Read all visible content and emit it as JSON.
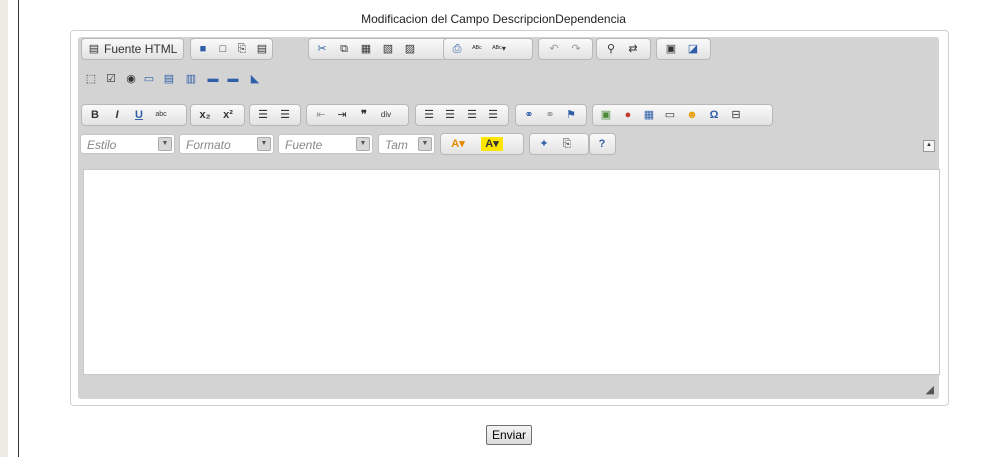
{
  "page": {
    "title": "Modificacion del Campo DescripcionDependencia",
    "submit_label": "Enviar"
  },
  "toolbar1": {
    "source_label": "Fuente HTML",
    "icons": [
      "save-icon",
      "new-page-icon",
      "preview-icon",
      "templates-icon",
      "cut-icon",
      "copy-icon",
      "paste-icon",
      "paste-text-icon",
      "paste-word-icon",
      "print-icon",
      "spellcheck-icon",
      "scayt-icon",
      "undo-icon",
      "redo-icon",
      "find-icon",
      "replace-icon",
      "select-all-icon",
      "remove-format-icon"
    ]
  },
  "toolbar2": {
    "icons": [
      "form-icon",
      "checkbox-icon",
      "radio-icon",
      "text-field-icon",
      "textarea-icon",
      "select-field-icon",
      "button-icon",
      "image-button-icon",
      "hidden-field-icon"
    ]
  },
  "toolbar3": {
    "icons": [
      "bold-icon",
      "italic-icon",
      "underline-icon",
      "strike-icon",
      "subscript-icon",
      "superscript-icon",
      "numbered-list-icon",
      "bulleted-list-icon",
      "outdent-icon",
      "indent-icon",
      "blockquote-icon",
      "creatediv-icon",
      "align-left-icon",
      "align-center-icon",
      "align-right-icon",
      "justify-icon",
      "link-icon",
      "unlink-icon",
      "anchor-icon",
      "image-icon",
      "flash-icon",
      "table-icon",
      "horizontal-rule-icon",
      "smiley-icon",
      "special-char-icon",
      "page-break-icon"
    ]
  },
  "toolbar4": {
    "style_placeholder": "Estilo",
    "format_placeholder": "Formato",
    "font_placeholder": "Fuente",
    "size_placeholder": "Tam",
    "icons": [
      "text-color-icon",
      "bg-color-icon",
      "maximize-icon",
      "show-blocks-icon",
      "about-icon"
    ]
  }
}
